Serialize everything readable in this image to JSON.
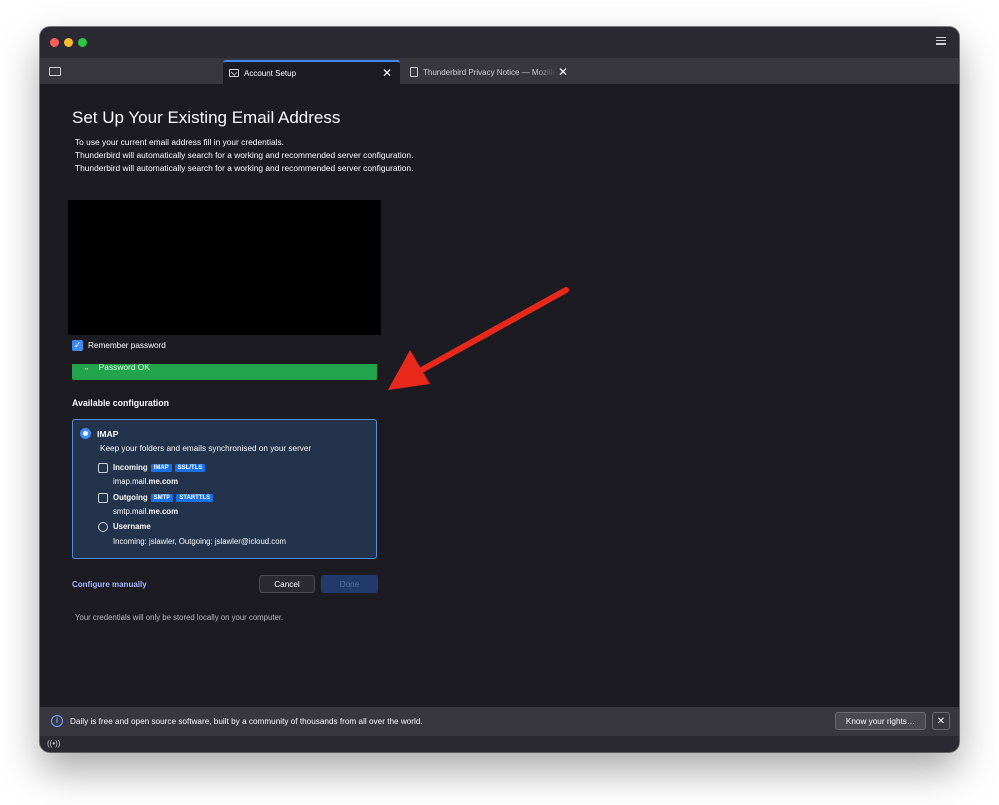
{
  "window": {
    "tabs": [
      {
        "label": "Account Setup",
        "icon": "mail-icon",
        "active": true
      },
      {
        "label": "Thunderbird Privacy Notice — Mozilla",
        "icon": "document-icon",
        "active": false
      }
    ]
  },
  "main": {
    "heading": "Set Up Your Existing Email Address",
    "description": [
      "To use your current email address fill in your credentials.",
      "Thunderbird will automatically search for a working and recommended server configuration.",
      "Thunderbird will automatically search for a working and recommended server configuration."
    ],
    "remember_password": {
      "label": "Remember password",
      "checked": true
    },
    "password_status": "Password OK",
    "available_config_title": "Available configuration",
    "config": {
      "protocol": "IMAP",
      "description": "Keep your folders and emails synchronised on your server",
      "incoming": {
        "label": "Incoming",
        "badges": [
          "IMAP",
          "SSL/TLS"
        ],
        "host_prefix": "imap.mail.",
        "host_domain": "me.com"
      },
      "outgoing": {
        "label": "Outgoing",
        "badges": [
          "SMTP",
          "STARTTLS"
        ],
        "host_prefix": "smtp.mail.",
        "host_domain": "me.com"
      },
      "username": {
        "label": "Username",
        "value": "Incoming: jslawler, Outgoing: jslawler@icloud.com"
      }
    },
    "configure_manually": "Configure manually",
    "cancel_label": "Cancel",
    "done_label": "Done",
    "footnote": "Your credentials will only be stored locally on your computer."
  },
  "notification": {
    "text": "Daily is free and open source software, built by a community of thousands from all over the world.",
    "button_label": "Know your rights…"
  },
  "colors": {
    "accent": "#3d8bf4",
    "success": "#22a44c",
    "annotation_arrow": "#e8281b"
  }
}
